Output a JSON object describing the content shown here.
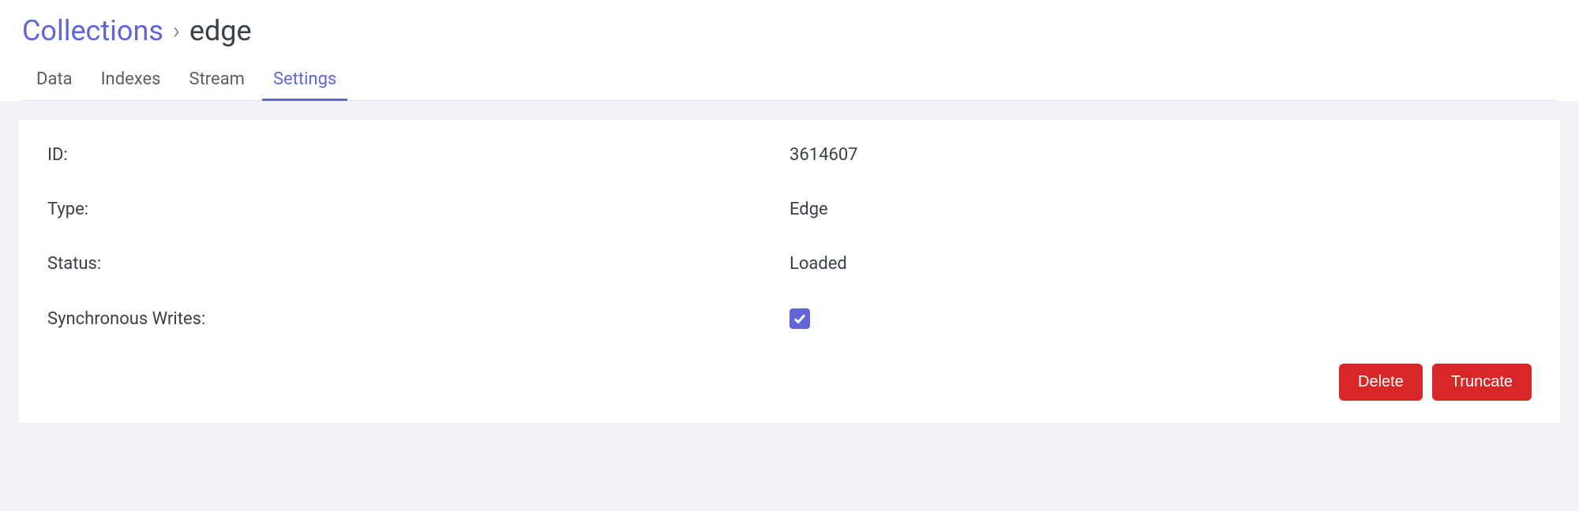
{
  "breadcrumb": {
    "root": "Collections",
    "current": "edge"
  },
  "tabs": {
    "data": "Data",
    "indexes": "Indexes",
    "stream": "Stream",
    "settings": "Settings"
  },
  "fields": {
    "id": {
      "label": "ID:",
      "value": "3614607"
    },
    "type": {
      "label": "Type:",
      "value": "Edge"
    },
    "status": {
      "label": "Status:",
      "value": "Loaded"
    },
    "syncWrites": {
      "label": "Synchronous Writes:",
      "checked": true
    }
  },
  "buttons": {
    "delete": "Delete",
    "truncate": "Truncate"
  }
}
